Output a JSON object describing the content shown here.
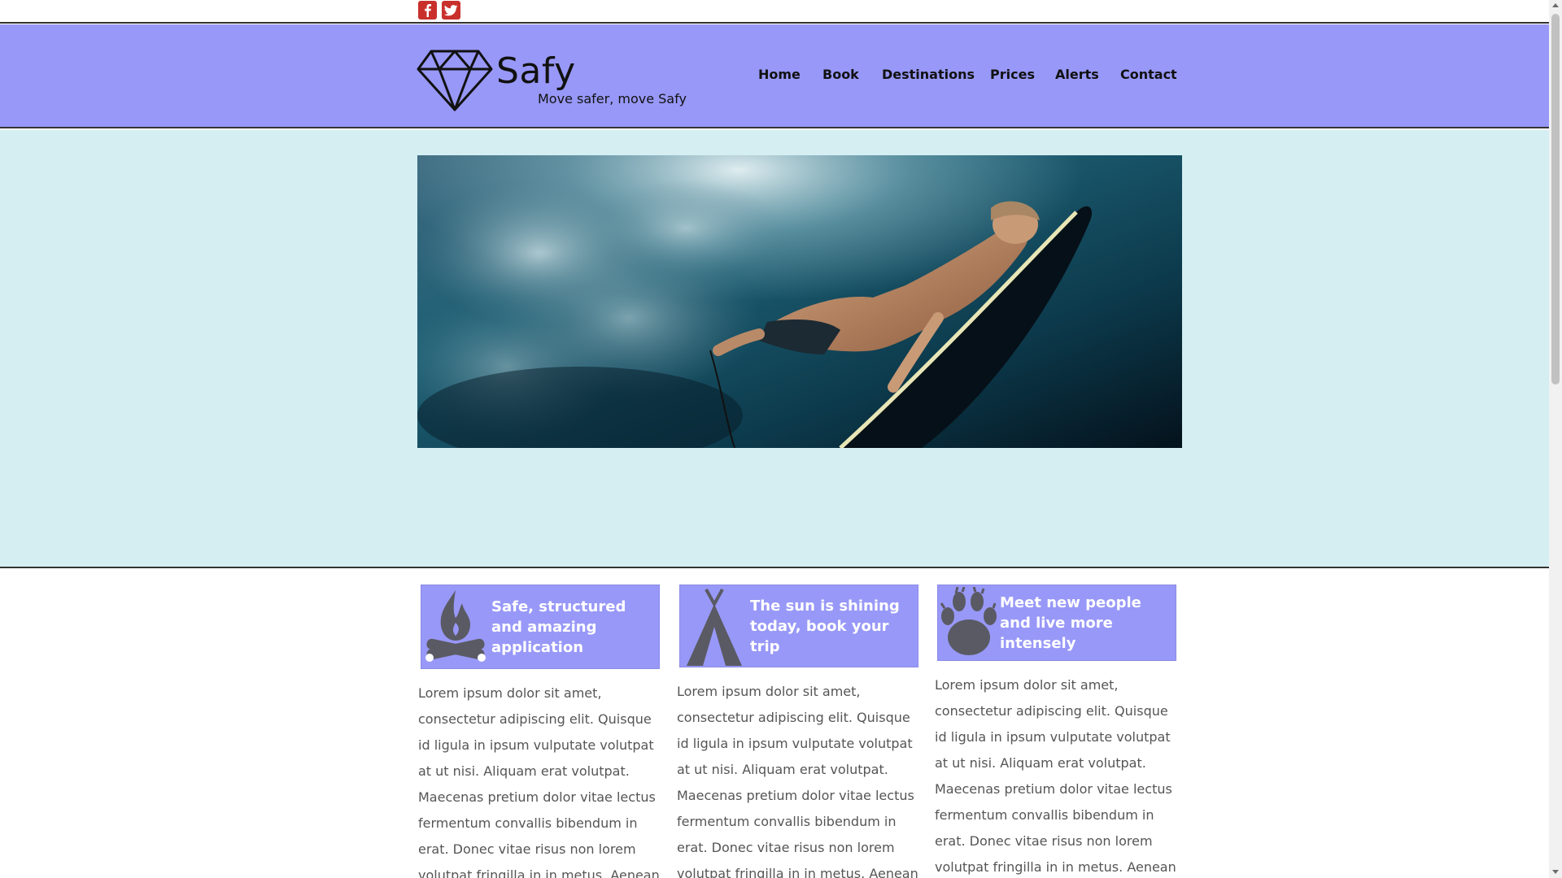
{
  "social": {
    "facebook_icon": "facebook-icon",
    "twitter_icon": "twitter-icon",
    "color": "#c9302c"
  },
  "header": {
    "brand": "Safy",
    "tagline": "Move safer, move Safy",
    "background": "#9898f8",
    "nav": [
      {
        "label": "Home"
      },
      {
        "label": "Book"
      },
      {
        "label": "Destinations"
      },
      {
        "label": "Prices"
      },
      {
        "label": "Alerts"
      },
      {
        "label": "Contact"
      }
    ]
  },
  "hero": {
    "background": "#d4eef2",
    "image": "surfer-underwater-photo"
  },
  "features": [
    {
      "icon": "campfire-icon",
      "title": "Safe, structured and amazing application",
      "text": "Lorem ipsum dolor sit amet, consectetur adipiscing elit. Quisque id ligula in ipsum vulputate volutpat at ut nisi. Aliquam erat volutpat. Maecenas pretium dolor vitae lectus fermentum convallis bibendum in erat. Donec vitae risus non lorem volutpat fringilla in in metus. Aenean quis eros diam. Proin"
    },
    {
      "icon": "tent-icon",
      "title": "The sun is shining today, book your trip",
      "text": "Lorem ipsum dolor sit amet, consectetur adipiscing elit. Quisque id ligula in ipsum vulputate volutpat at ut nisi. Aliquam erat volutpat. Maecenas pretium dolor vitae lectus fermentum convallis bibendum in erat. Donec vitae risus non lorem volutpat fringilla in in metus. Aenean quis eros diam. Proin"
    },
    {
      "icon": "paw-icon",
      "title": "Meet new people and live more intensely",
      "text": "Lorem ipsum dolor sit amet, consectetur adipiscing elit. Quisque id ligula in ipsum vulputate volutpat at ut nisi. Aliquam erat volutpat. Maecenas pretium dolor vitae lectus fermentum convallis bibendum in erat. Donec vitae risus non lorem volutpat fringilla in in metus. Aenean quis eros diam. Proin"
    }
  ]
}
